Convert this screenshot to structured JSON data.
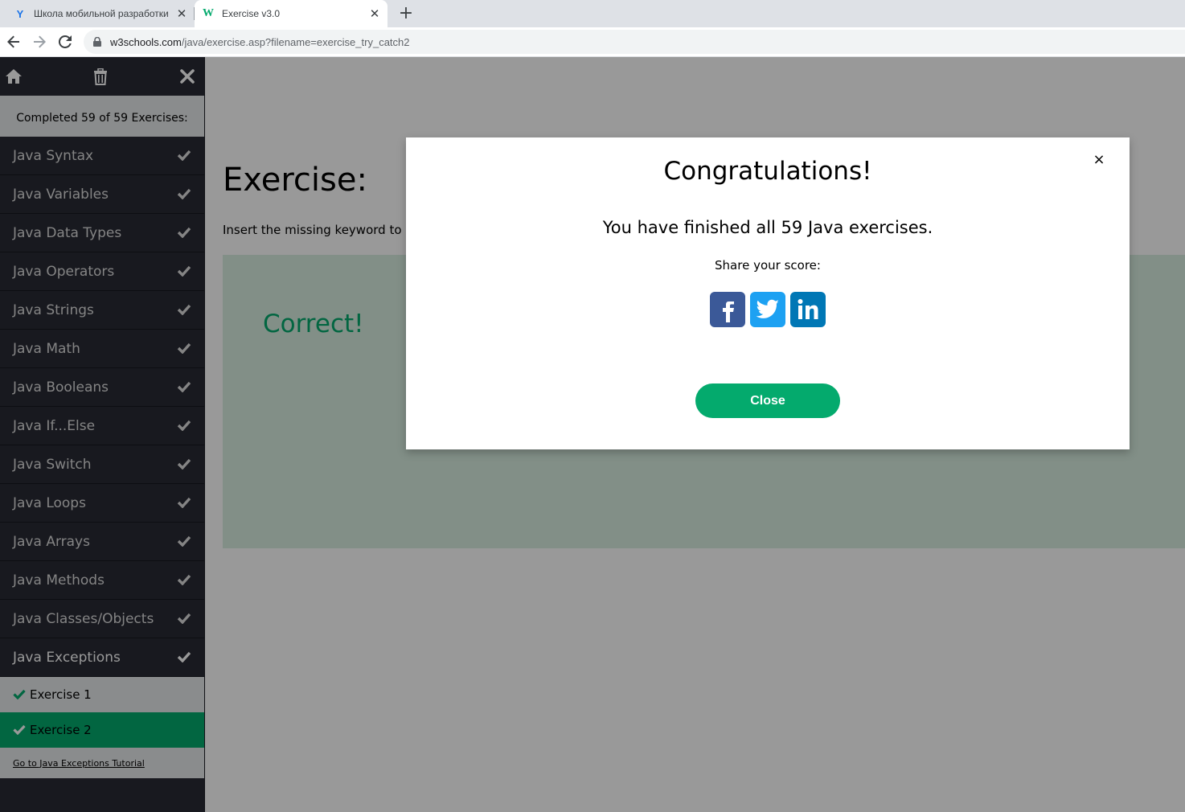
{
  "browser": {
    "tabs": [
      {
        "title": "Школа мобильной разработки",
        "favicon": "yandex-y-icon"
      },
      {
        "title": "Exercise v3.0",
        "favicon": "w3schools-icon",
        "active": true
      }
    ],
    "new_tab_label": "+",
    "url_host": "w3schools.com",
    "url_path": "/java/exercise.asp?filename=exercise_try_catch2"
  },
  "sidebar": {
    "progress_text": "Completed 59 of 59 Exercises:",
    "chapters": [
      {
        "label": "Java Syntax"
      },
      {
        "label": "Java Variables"
      },
      {
        "label": "Java Data Types"
      },
      {
        "label": "Java Operators"
      },
      {
        "label": "Java Strings"
      },
      {
        "label": "Java Math"
      },
      {
        "label": "Java Booleans"
      },
      {
        "label": "Java If...Else"
      },
      {
        "label": "Java Switch"
      },
      {
        "label": "Java Loops"
      },
      {
        "label": "Java Arrays"
      },
      {
        "label": "Java Methods"
      },
      {
        "label": "Java Classes/Objects"
      },
      {
        "label": "Java Exceptions"
      }
    ],
    "sub_items": [
      {
        "label": "Exercise 1"
      },
      {
        "label": "Exercise 2"
      }
    ],
    "tutorial_link": "Go to Java Exceptions Tutorial"
  },
  "main": {
    "title": "Exercise:",
    "description": "Insert the missing keyword to",
    "result_text": "Correct!"
  },
  "modal": {
    "title": "Congratulations!",
    "message": "You have finished all 59 Java exercises.",
    "share_label": "Share your score:",
    "close_x": "×",
    "close_button": "Close"
  },
  "colors": {
    "accent": "#04aa6d",
    "sidebar_bg": "#282a35",
    "facebook": "#3b5998",
    "twitter": "#1da1f2",
    "linkedin": "#0077b5"
  }
}
